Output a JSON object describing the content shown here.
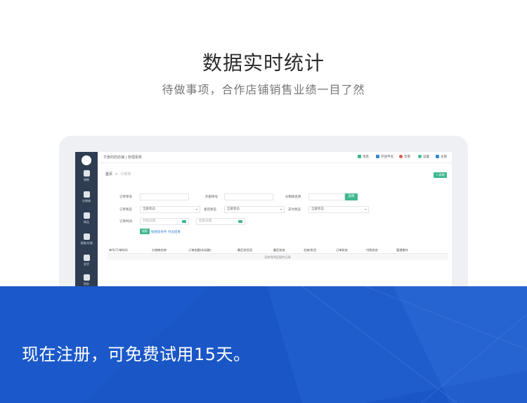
{
  "hero": {
    "title": "数据实时统计",
    "subtitle": "待做事项，合作店铺销售业绩一目了然"
  },
  "app": {
    "title": "华景的的店铺 | 管理系统",
    "topbar": [
      {
        "label": "消息",
        "icon": "message-icon",
        "color": "#3eb88f"
      },
      {
        "label": "开放平台",
        "icon": "open-platform-icon",
        "color": "#3a86d1"
      },
      {
        "label": "华景",
        "icon": "user-icon",
        "color": "#e05a4f"
      },
      {
        "label": "设置",
        "icon": "settings-icon",
        "color": "#3eb88f"
      },
      {
        "label": "主管",
        "icon": "manager-icon",
        "color": "#3a86d1"
      }
    ],
    "sidebar": [
      {
        "label": "销售",
        "icon": "sales-icon"
      },
      {
        "label": "分销商",
        "icon": "distributor-icon"
      },
      {
        "label": "商品",
        "icon": "goods-icon"
      },
      {
        "label": "采购/仓储",
        "icon": "purchase-icon"
      },
      {
        "label": "发货",
        "icon": "shipping-icon"
      },
      {
        "label": "财务",
        "icon": "finance-icon"
      }
    ],
    "breadcrumb": {
      "home": "首页",
      "separator": ">",
      "current": "订单列"
    },
    "new_button": "+ 新增",
    "filters": {
      "order_no_label": "订单单号",
      "external_no_label": "外部单号",
      "distributor_label": "分销商名称",
      "select_button": "选择",
      "order_status_label": "订单状态",
      "order_status_value": "全部状态",
      "ship_status_label": "发货状态",
      "ship_status_value": "全部状态",
      "pay_status_label": "支付状态",
      "pay_status_value": "全部状态",
      "order_time_label": "订单时间",
      "start_date_placeholder": "开始日期",
      "end_date_placeholder": "结束日期",
      "search_button": "搜索",
      "export_link": "按搜索条件 导出结果"
    },
    "table": {
      "columns": [
        "单号/下单时间",
        "分销商名称",
        "订单金额(实际数)",
        "最后发货项",
        "最后状态",
        "总商/发货",
        "订单状态",
        "付款状态",
        "管理操作"
      ],
      "empty_text": "没有找到匹配的记录"
    }
  },
  "banner": {
    "text": "现在注册，可免费试用15天。",
    "color": "#1a56c6"
  }
}
